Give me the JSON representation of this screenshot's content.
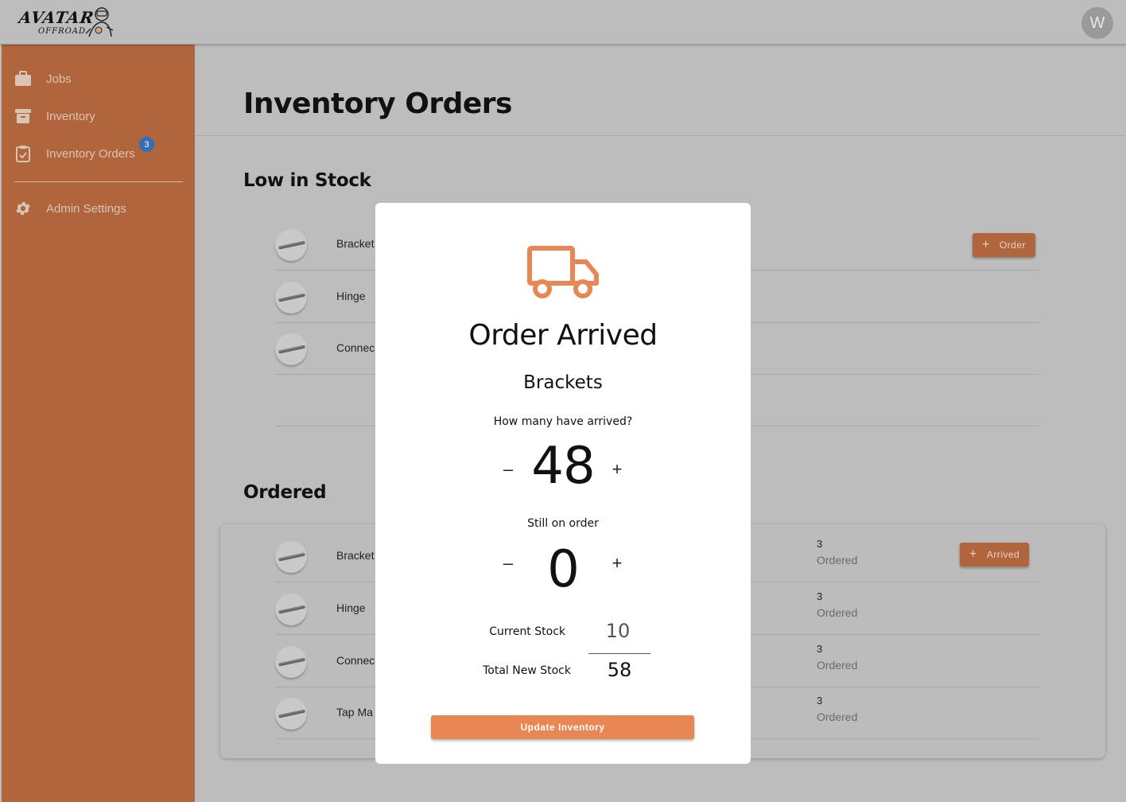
{
  "brand": {
    "logo_text": "AVATAR",
    "logo_subtext": "OFFROAD",
    "avatar_initial": "W"
  },
  "sidebar": {
    "items": [
      {
        "label": "Jobs",
        "icon": "briefcase-icon"
      },
      {
        "label": "Inventory",
        "icon": "archive-box-icon"
      },
      {
        "label": "Inventory Orders",
        "icon": "clipboard-check-icon",
        "badge": "3"
      },
      {
        "label": "Admin Settings",
        "icon": "gear-icon"
      }
    ]
  },
  "page": {
    "title": "Inventory Orders",
    "low_stock": {
      "title": "Low in Stock",
      "rows": [
        {
          "name": "Bracket"
        },
        {
          "name": "Hinge"
        },
        {
          "name": "Connec"
        }
      ],
      "order_button": "Order"
    },
    "ordered": {
      "title": "Ordered",
      "rows": [
        {
          "name": "Bracket",
          "qty": "3",
          "qty_label": "Ordered"
        },
        {
          "name": "Hinge",
          "qty": "3",
          "qty_label": "Ordered"
        },
        {
          "name": "Connec",
          "qty": "3",
          "qty_label": "Ordered"
        },
        {
          "name": "Tap Ma",
          "qty": "3",
          "qty_label": "Ordered"
        }
      ],
      "arrived_button": "Arrived"
    }
  },
  "modal": {
    "title": "Order Arrived",
    "item_name": "Brackets",
    "arrived_question": "How many have arrived?",
    "arrived_count": "48",
    "still_on_order_label": "Still on order",
    "still_on_order_count": "0",
    "current_stock_label": "Current Stock",
    "current_stock_value": "10",
    "total_new_stock_label": "Total New Stock",
    "total_new_stock_value": "58",
    "minus_glyph": "–",
    "plus_glyph": "+",
    "update_button": "Update Inventory"
  },
  "colors": {
    "sidebar": "#b0653d",
    "accent": "#e88753",
    "badge": "#2e6fb8",
    "overlay_bg": "#bdbdbd"
  }
}
